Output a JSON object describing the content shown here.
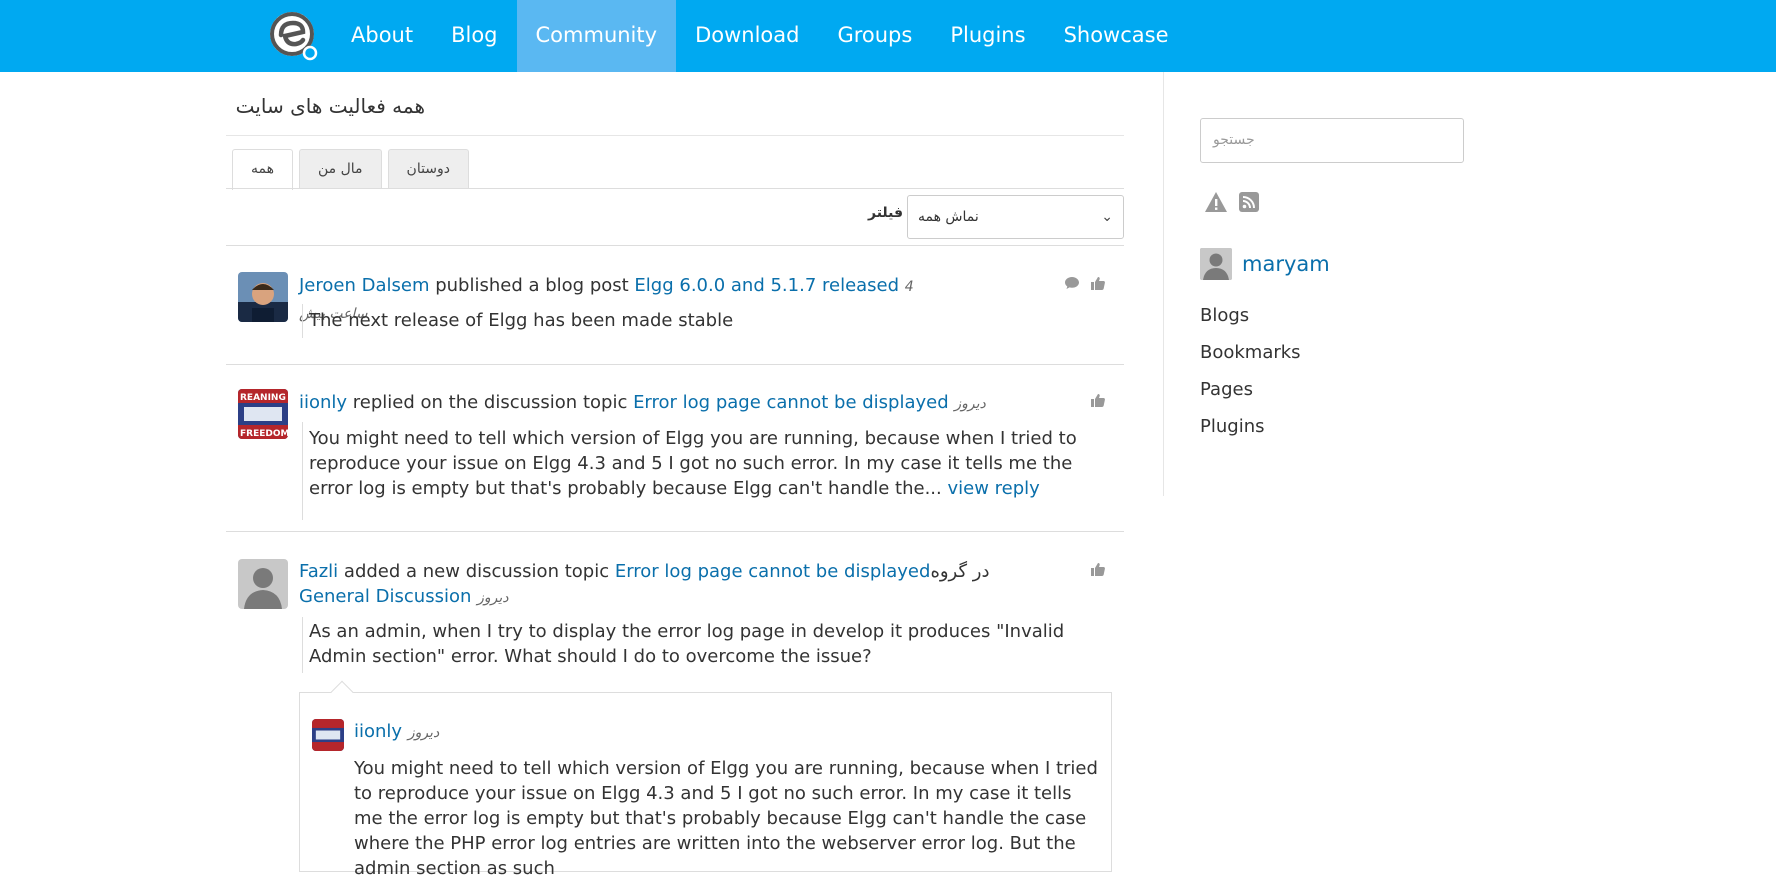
{
  "nav": {
    "logo_icon": "elgg-logo-icon",
    "items": [
      {
        "label": "About"
      },
      {
        "label": "Blog"
      },
      {
        "label": "Community",
        "active": true
      },
      {
        "label": "Download"
      },
      {
        "label": "Groups"
      },
      {
        "label": "Plugins"
      },
      {
        "label": "Showcase"
      }
    ],
    "colors": {
      "bar": "#00a9f1",
      "active": "#5ab8f2"
    }
  },
  "page": {
    "title": "همه فعالیت های سایت",
    "tabs": [
      {
        "label": "همه",
        "active": true
      },
      {
        "label": "مال من"
      },
      {
        "label": "دوستان"
      }
    ],
    "filter_label": "فیلتر",
    "filter_value": "نماش همه"
  },
  "activity": [
    {
      "user": "Jeroen Dalsem",
      "action": " published a blog post ",
      "target": "Elgg 6.0.0 and 5.1.7 released",
      "time": "4 ساعت پیش",
      "excerpt": "The next release of Elgg has been made stable",
      "icons": [
        "comment-icon",
        "thumbs-up-icon"
      ]
    },
    {
      "user": "iionly",
      "action": " replied on the discussion topic ",
      "target": "Error log page cannot be displayed",
      "time": "دیروز",
      "excerpt": "You might need to tell which version of Elgg you are running, because when I tried to reproduce your issue on Elgg 4.3 and 5 I got no such error. In my case it tells me the error log is empty but that's probably because Elgg can't handle the...",
      "more_link": "view reply",
      "icons": [
        "thumbs-up-icon"
      ]
    },
    {
      "user": "Fazli",
      "action": " added a new discussion topic ",
      "target": "Error log page cannot be displayed",
      "group_prefix": " در گروه ",
      "group": "General Discussion",
      "time": "دیروز",
      "excerpt": "As an admin, when I try to display the error log page in develop it produces \"Invalid Admin section\" error.  What should I do to overcome the issue?",
      "icons": [
        "thumbs-up-icon"
      ],
      "reply": {
        "user": "iionly",
        "time": "دیروز",
        "text": "You might need to tell which version of Elgg you are running, because when I tried to reproduce your issue on Elgg 4.3 and 5 I got no such error. In my case it tells me the error log is empty but that's probably because Elgg can't handle the case where the PHP error log entries are written into the webserver error log. But the admin section as such"
      }
    }
  ],
  "sidebar": {
    "search_placeholder": "جستجو",
    "icons": [
      "warning-icon",
      "rss-icon"
    ],
    "username": "maryam",
    "menu": [
      "Blogs",
      "Bookmarks",
      "Pages",
      "Plugins"
    ]
  }
}
